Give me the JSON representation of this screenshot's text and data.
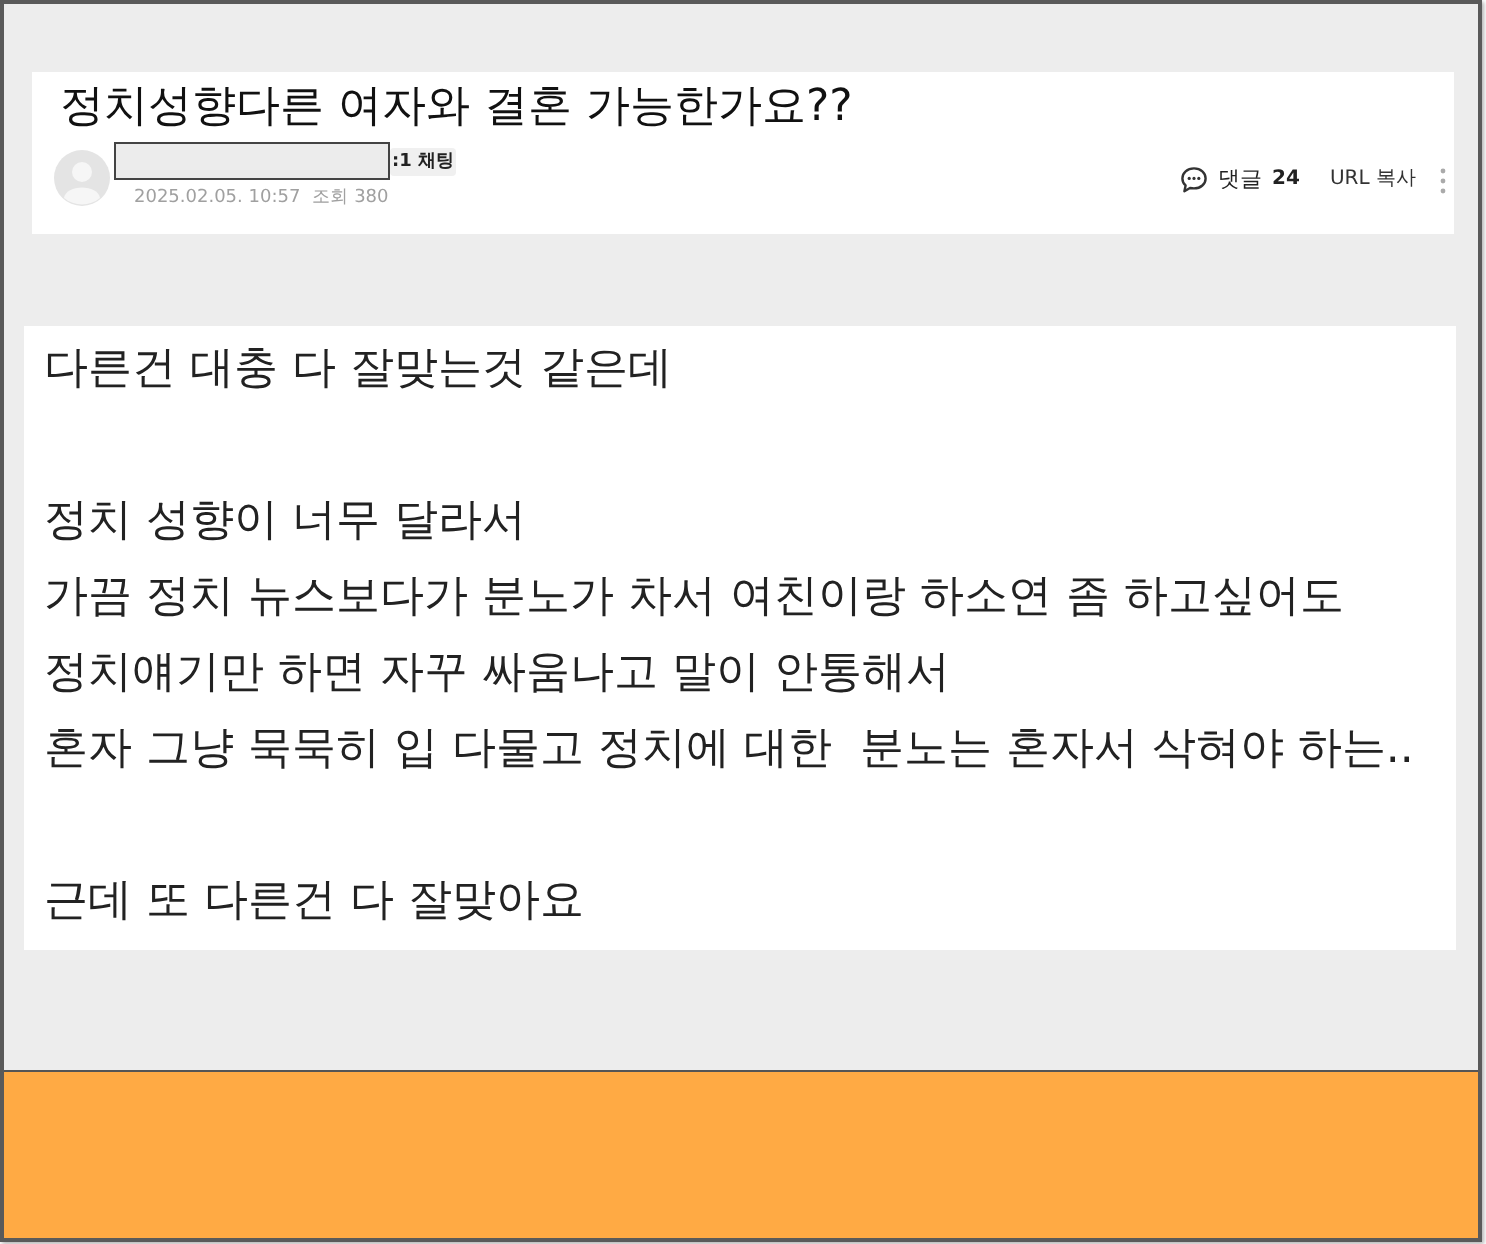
{
  "post": {
    "title": "정치성향다른 여자와 결혼 가능한가요??",
    "chat_badge": ":1 채팅",
    "date": "2025.02.05. 10:57",
    "views": "조회 380",
    "comments_label": "댓글",
    "comments_count": "24",
    "url_copy": "URL 복사"
  },
  "body": {
    "paragraphs": [
      [
        "다른건 대충 다 잘맞는것 같은데"
      ],
      [
        "정치 성향이 너무 달라서",
        "가끔 정치 뉴스보다가 분노가 차서 여친이랑 하소연 좀 하고싶어도",
        "정치얘기만 하면 자꾸 싸움나고 말이 안통해서",
        "혼자 그냥 묵묵히 입 다물고 정치에 대한  분노는 혼자서 삭혀야 하는.."
      ],
      [
        "근데 또 다른건 다 잘맞아요"
      ]
    ]
  }
}
